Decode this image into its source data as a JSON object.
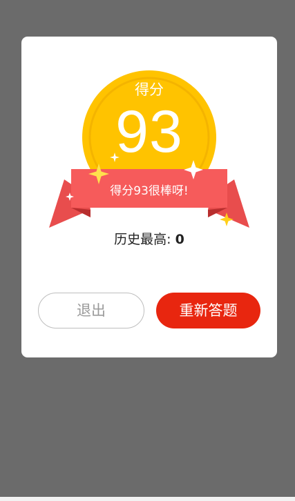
{
  "colors": {
    "backdrop": "#6b6b6b",
    "dialog": "#ffffff",
    "coin": "#ffc300",
    "coin_rim": "#f4b400",
    "ribbon": "#f65b5b",
    "ribbon_dark": "#d63b3b",
    "primary_button": "#e8260f"
  },
  "result": {
    "score_label": "得分",
    "score": "93",
    "ribbon_message": "得分93很棒呀!",
    "best_label": "历史最高: ",
    "best_value": "0"
  },
  "buttons": {
    "exit_label": "退出",
    "retry_label": "重新答题"
  },
  "icons": [
    "coin-medal-icon",
    "ribbon-banner-icon",
    "sparkle-icon"
  ]
}
